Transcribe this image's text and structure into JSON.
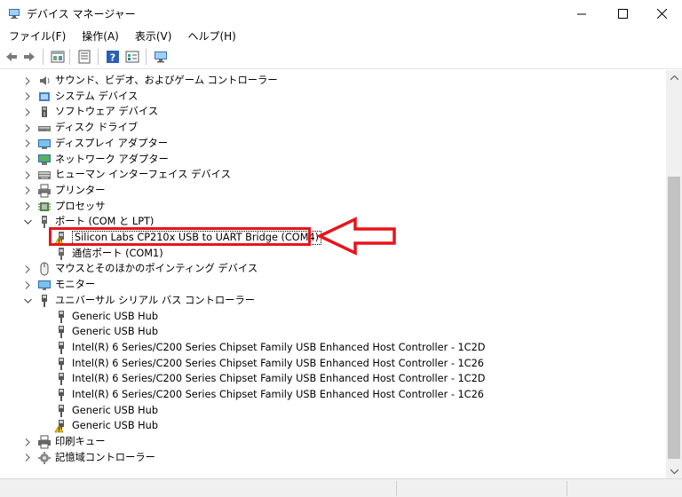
{
  "window": {
    "title": "デバイス マネージャー"
  },
  "menu": [
    {
      "label": "ファイル(F)"
    },
    {
      "label": "操作(A)"
    },
    {
      "label": "表示(V)"
    },
    {
      "label": "ヘルプ(H)"
    }
  ],
  "toolbar": [
    "back-icon",
    "forward-icon",
    "device-view-icon",
    "properties-icon",
    "help-icon",
    "list-view-icon",
    "monitor-icon"
  ],
  "tree": [
    {
      "label": "サウンド、ビデオ、およびゲーム コントローラー",
      "expander": "collapsed",
      "icon": "speaker-icon",
      "level": 0
    },
    {
      "label": "システム デバイス",
      "expander": "collapsed",
      "icon": "system-device-icon",
      "level": 0
    },
    {
      "label": "ソフトウェア デバイス",
      "expander": "collapsed",
      "icon": "software-device-icon",
      "level": 0
    },
    {
      "label": "ディスク ドライブ",
      "expander": "collapsed",
      "icon": "disk-drive-icon",
      "level": 0
    },
    {
      "label": "ディスプレイ アダプター",
      "expander": "collapsed",
      "icon": "display-adapter-icon",
      "level": 0
    },
    {
      "label": "ネットワーク アダプター",
      "expander": "collapsed",
      "icon": "network-adapter-icon",
      "level": 0
    },
    {
      "label": "ヒューマン インターフェイス デバイス",
      "expander": "collapsed",
      "icon": "hid-icon",
      "level": 0
    },
    {
      "label": "プリンター",
      "expander": "collapsed",
      "icon": "printer-icon",
      "level": 0
    },
    {
      "label": "プロセッサ",
      "expander": "collapsed",
      "icon": "processor-icon",
      "level": 0
    },
    {
      "label": "ポート (COM と LPT)",
      "expander": "expanded",
      "icon": "port-icon",
      "level": 0
    },
    {
      "label": "Silicon Labs CP210x USB to UART Bridge (COM4)",
      "expander": "none",
      "icon": "warning-port-icon",
      "level": 1,
      "selected": true
    },
    {
      "label": "通信ポート (COM1)",
      "expander": "none",
      "icon": "port-icon",
      "level": 1
    },
    {
      "label": "マウスとそのほかのポインティング デバイス",
      "expander": "collapsed",
      "icon": "mouse-icon",
      "level": 0
    },
    {
      "label": "モニター",
      "expander": "collapsed",
      "icon": "monitor-icon",
      "level": 0
    },
    {
      "label": "ユニバーサル シリアル バス コントローラー",
      "expander": "expanded",
      "icon": "usb-icon",
      "level": 0
    },
    {
      "label": "Generic USB Hub",
      "expander": "none",
      "icon": "usb-icon",
      "level": 1
    },
    {
      "label": "Generic USB Hub",
      "expander": "none",
      "icon": "usb-icon",
      "level": 1
    },
    {
      "label": "Intel(R) 6 Series/C200 Series Chipset Family USB Enhanced Host Controller - 1C2D",
      "expander": "none",
      "icon": "usb-icon",
      "level": 1
    },
    {
      "label": "Intel(R) 6 Series/C200 Series Chipset Family USB Enhanced Host Controller - 1C26",
      "expander": "none",
      "icon": "usb-icon",
      "level": 1
    },
    {
      "label": "Intel(R) 6 Series/C200 Series Chipset Family USB Enhanced Host Controller - 1C2D",
      "expander": "none",
      "icon": "usb-icon",
      "level": 1
    },
    {
      "label": "Intel(R) 6 Series/C200 Series Chipset Family USB Enhanced Host Controller - 1C26",
      "expander": "none",
      "icon": "usb-icon",
      "level": 1
    },
    {
      "label": "Generic USB Hub",
      "expander": "none",
      "icon": "usb-icon",
      "level": 1
    },
    {
      "label": "Generic USB Hub",
      "expander": "none",
      "icon": "warning-usb-icon",
      "level": 1
    },
    {
      "label": "印刷キュー",
      "expander": "collapsed",
      "icon": "print-queue-icon",
      "level": 0
    },
    {
      "label": "記憶域コントローラー",
      "expander": "collapsed",
      "icon": "storage-controller-icon",
      "level": 0
    }
  ],
  "colors": {
    "highlight": "#e8141c",
    "warning": "#f5c400"
  }
}
